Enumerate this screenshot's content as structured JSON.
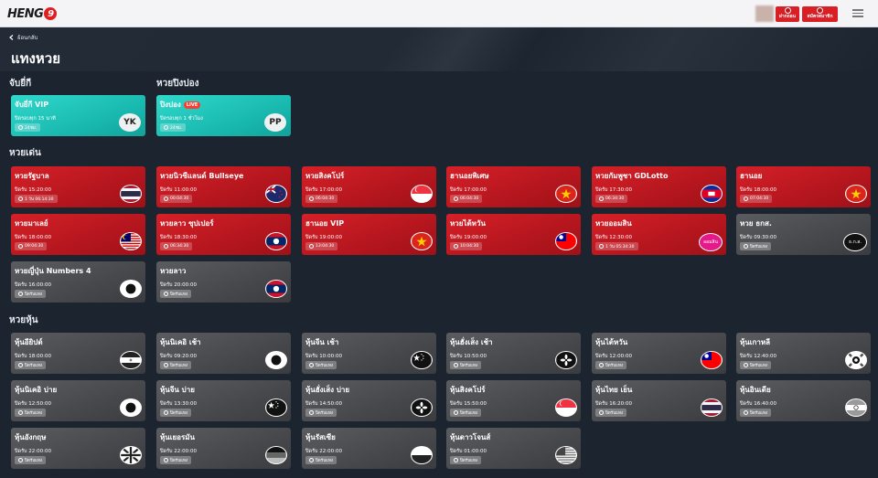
{
  "header": {
    "logo": "HENG",
    "logo_badge": "9",
    "btn_deposit": "ฝากถอน",
    "btn_register": "สมัครสมาชิก"
  },
  "back_label": "ย้อนกลับ",
  "page_title": "แทงหวย",
  "sections": {
    "yeekee": "จับยี่กี",
    "pingpong": "หวยปิงปอง",
    "lotto": "หวยเด่น",
    "stock": "หวยหุ้น"
  },
  "special_cards": [
    {
      "name": "จับยี่กี VIP",
      "sub": "ปิดรอบทุก 15 นาที",
      "badge": "24ชม.",
      "icon": "YK"
    },
    {
      "name": "ปิงปอง",
      "live": "LIVE",
      "sub": "ปิดรอบทุก 1 ชั่วโมง",
      "badge": "24ชม.",
      "icon": "PP"
    }
  ],
  "lotto_cards": [
    {
      "name": "หวยรัฐบาล",
      "sub": "ปิดรับ 15:20:00",
      "badge": "1 วัน 06:14:30",
      "icon": "thailand-flag"
    },
    {
      "name": "หวยนิวซีแลนด์ Bullseye",
      "sub": "ปิดรับ 11:00:00",
      "badge": "00:04:30",
      "icon": "new-zealand-flag"
    },
    {
      "name": "หวยสิงคโปร์",
      "sub": "ปิดรับ 17:00:00",
      "badge": "06:04:30",
      "icon": "singapore-flag"
    },
    {
      "name": "ฮานอยพิเศษ",
      "sub": "ปิดรับ 17:00:00",
      "badge": "06:04:30",
      "icon": "vietnam-flag"
    },
    {
      "name": "หวยกัมพูชา GDLotto",
      "sub": "ปิดรับ 17:30:00",
      "badge": "06:34:30",
      "icon": "cambodia-flag"
    },
    {
      "name": "ฮานอย",
      "sub": "ปิดรับ 18:00:00",
      "badge": "07:04:30",
      "icon": "vietnam-flag"
    },
    {
      "name": "หวยมาเลย์",
      "sub": "ปิดรับ 18:00:00",
      "badge": "09:04:30",
      "icon": "malaysia-flag"
    },
    {
      "name": "หวยลาว ซุปเปอร์",
      "sub": "ปิดรับ 18:30:00",
      "badge": "06:34:30",
      "icon": "laos-flag"
    },
    {
      "name": "ฮานอย VIP",
      "sub": "ปิดรับ 19:00:00",
      "badge": "13:04:30",
      "icon": "vietnam-flag"
    },
    {
      "name": "หวยไต้หวัน",
      "sub": "ปิดรับ 19:00:00",
      "badge": "10:04:30",
      "icon": "taiwan-flag"
    },
    {
      "name": "หวยออมสิน",
      "sub": "ปิดรับ 12:30:00",
      "badge": "1 วัน 05:34:30",
      "icon": "gsb-logo",
      "icon_text": "ออมสิน"
    },
    {
      "name": "หวย ธกส.",
      "sub": "ปิดรับ 09:30:00",
      "badge": "ปิดรับแทง",
      "icon": "baac-logo",
      "icon_text": "ธ.ก.ส."
    },
    {
      "name": "หวยญี่ปุ่น Numbers 4",
      "sub": "ปิดรับ 16:00:00",
      "badge": "ปิดรับแทง",
      "icon": "japan-flag"
    },
    {
      "name": "หวยลาว",
      "sub": "ปิดรับ 20:00:00",
      "badge": "ปิดรับแทง",
      "icon": "laos-flag"
    }
  ],
  "stock_cards": [
    {
      "name": "หุ้นอียิปต์",
      "sub": "ปิดรับ 18:00:00",
      "badge": "ปิดรับแทง",
      "icon": "egypt-flag"
    },
    {
      "name": "หุ้นนิเคอิ เช้า",
      "sub": "ปิดรับ 09:20:00",
      "badge": "ปิดรับแทง",
      "icon": "japan-flag"
    },
    {
      "name": "หุ้นจีน เช้า",
      "sub": "ปิดรับ 10:00:00",
      "badge": "ปิดรับแทง",
      "icon": "china-flag"
    },
    {
      "name": "หุ้นฮั่งเส็ง เช้า",
      "sub": "ปิดรับ 10:50:00",
      "badge": "ปิดรับแทง",
      "icon": "hongkong-flag"
    },
    {
      "name": "หุ้นไต้หวัน",
      "sub": "ปิดรับ 12:00:00",
      "badge": "ปิดรับแทง",
      "icon": "taiwan-flag"
    },
    {
      "name": "หุ้นเกาหลี",
      "sub": "ปิดรับ 12:40:00",
      "badge": "ปิดรับแทง",
      "icon": "korea-flag"
    },
    {
      "name": "หุ้นนิเคอิ บ่าย",
      "sub": "ปิดรับ 12:50:00",
      "badge": "ปิดรับแทง",
      "icon": "japan-flag"
    },
    {
      "name": "หุ้นจีน บ่าย",
      "sub": "ปิดรับ 13:30:00",
      "badge": "ปิดรับแทง",
      "icon": "china-flag"
    },
    {
      "name": "หุ้นฮั่งเส็ง บ่าย",
      "sub": "ปิดรับ 14:50:00",
      "badge": "ปิดรับแทง",
      "icon": "hongkong-flag"
    },
    {
      "name": "หุ้นสิงคโปร์",
      "sub": "ปิดรับ 15:50:00",
      "badge": "ปิดรับแทง",
      "icon": "singapore-flag"
    },
    {
      "name": "หุ้นไทย เย็น",
      "sub": "ปิดรับ 16:20:00",
      "badge": "ปิดรับแทง",
      "icon": "thailand-flag"
    },
    {
      "name": "หุ้นอินเดีย",
      "sub": "ปิดรับ 16:40:00",
      "badge": "ปิดรับแทง",
      "icon": "india-flag"
    },
    {
      "name": "หุ้นอังกฤษ",
      "sub": "ปิดรับ 22:00:00",
      "badge": "ปิดรับแทง",
      "icon": "uk-flag"
    },
    {
      "name": "หุ้นเยอรมัน",
      "sub": "ปิดรับ 22:00:00",
      "badge": "ปิดรับแทง",
      "icon": "germany-flag"
    },
    {
      "name": "หุ้นรัสเซีย",
      "sub": "ปิดรับ 22:00:00",
      "badge": "ปิดรับแทง",
      "icon": "russia-flag"
    },
    {
      "name": "หุ้นดาวโจนส์",
      "sub": "ปิดรับ 01:00:00",
      "badge": "ปิดรับแทง",
      "icon": "usa-flag"
    }
  ]
}
